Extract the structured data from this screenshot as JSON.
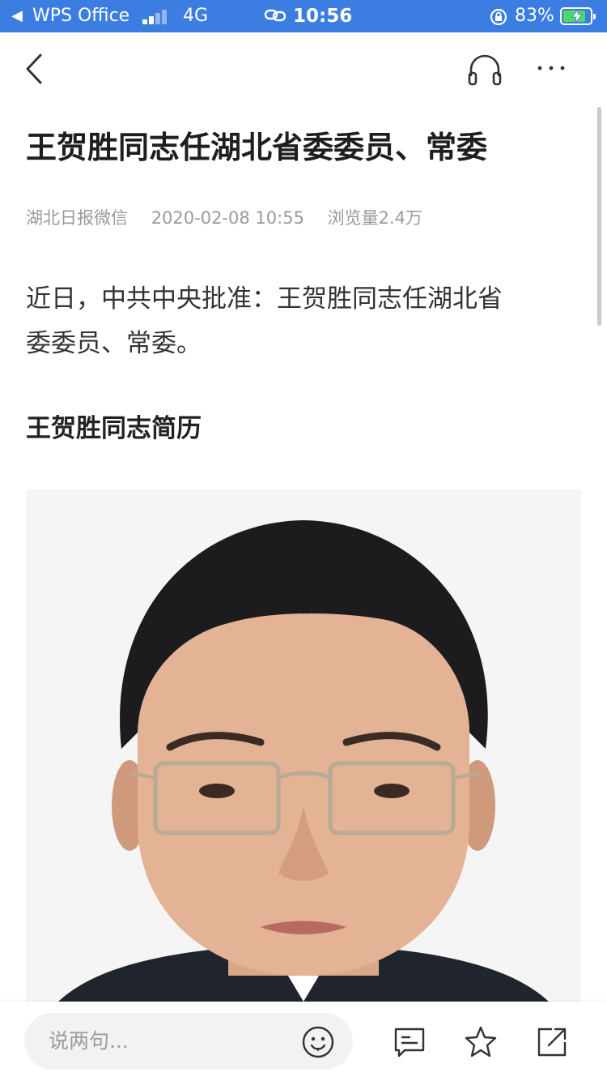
{
  "status_bar": {
    "app_name": "WPS Office",
    "network": "4G",
    "time": "10:56",
    "battery_percent": "83%",
    "battery_level": 0.83,
    "icons": [
      "back-arrow-icon",
      "signal-icon",
      "link-icon",
      "orientation-lock-icon",
      "battery-charging-icon"
    ]
  },
  "nav": {
    "icons": [
      "back-chevron-icon",
      "headphones-icon",
      "more-dots-icon"
    ]
  },
  "article": {
    "title": "王贺胜同志任湖北省委委员、常委",
    "source": "湖北日报微信",
    "datetime": "2020-02-08 10:55",
    "views": "浏览量2.4万",
    "body_line_1": "近日，中共中央批准：王贺胜同志任湖北省",
    "body_line_2": "委委员、常委。",
    "section_heading": "王贺胜同志简历",
    "photo_description": "portrait photo"
  },
  "bottom_bar": {
    "comment_placeholder": "说两句...",
    "icons": [
      "emoji-icon",
      "comments-icon",
      "star-icon",
      "share-icon"
    ]
  },
  "colors": {
    "status_bar_bg": "#3b7de0",
    "battery_fill": "#4cd964",
    "title_text": "#1e1e1e",
    "meta_text": "#9a9a9a",
    "comment_box_bg": "#f2f2f2"
  }
}
